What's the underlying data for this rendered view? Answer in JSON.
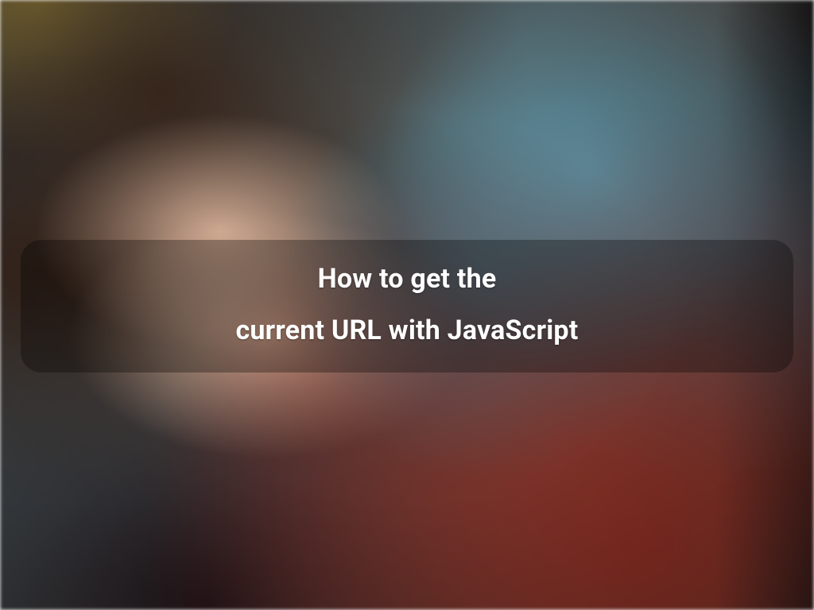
{
  "title": {
    "line1": "How to get the",
    "line2": "current URL with JavaScript"
  }
}
